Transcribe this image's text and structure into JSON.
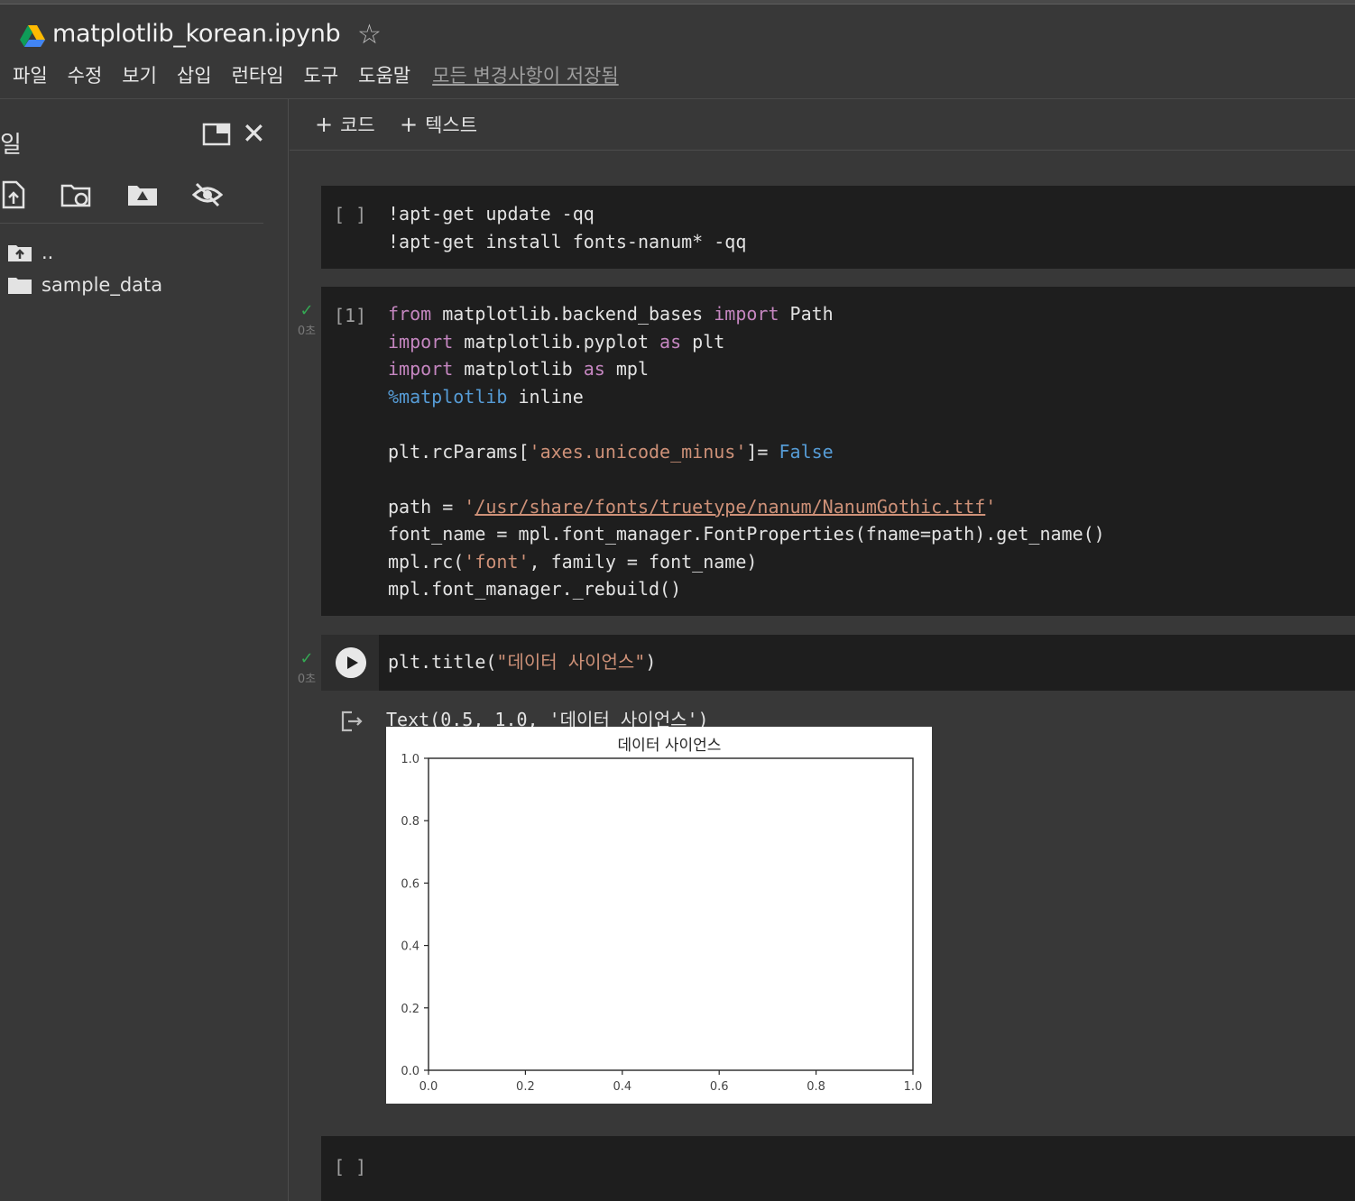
{
  "header": {
    "title": "matplotlib_korean.ipynb",
    "menu": [
      "파일",
      "수정",
      "보기",
      "삽입",
      "런타임",
      "도구",
      "도움말"
    ],
    "saved_status": "모든 변경사항이 저장됨"
  },
  "sidebar": {
    "title": "일",
    "files": [
      {
        "name": "..",
        "type": "parent"
      },
      {
        "name": "sample_data",
        "type": "folder"
      }
    ]
  },
  "toolbar": {
    "add_code": "코드",
    "add_text": "텍스트"
  },
  "cells": {
    "cell1": {
      "prompt": "[ ]",
      "lines": [
        "!apt-get update -qq",
        "!apt-get install fonts-nanum* -qq"
      ]
    },
    "cell2": {
      "prompt": "[1]",
      "exec_time": "0초"
    },
    "cell3": {
      "exec_time": "0초",
      "code": "plt.title(\"데이터 사이언스\")",
      "output_text": "Text(0.5, 1.0, '데이터 사이언스')"
    },
    "cell4": {
      "prompt": "[ ]"
    }
  },
  "chart_data": {
    "type": "line",
    "title": "데이터 사이언스",
    "x": [],
    "series": [],
    "xlim": [
      0.0,
      1.0
    ],
    "ylim": [
      0.0,
      1.0
    ],
    "xticks": [
      "0.0",
      "0.2",
      "0.4",
      "0.6",
      "0.8",
      "1.0"
    ],
    "yticks": [
      "0.0",
      "0.2",
      "0.4",
      "0.6",
      "0.8",
      "1.0"
    ],
    "grid": false
  }
}
